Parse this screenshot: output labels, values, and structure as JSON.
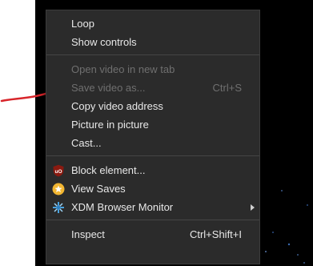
{
  "menu": {
    "items": [
      {
        "label": "Loop",
        "enabled": true
      },
      {
        "label": "Show controls",
        "enabled": true
      },
      {
        "label": "Open video in new tab",
        "enabled": false
      },
      {
        "label": "Save video as...",
        "shortcut": "Ctrl+S",
        "enabled": false
      },
      {
        "label": "Copy video address",
        "enabled": true
      },
      {
        "label": "Picture in picture",
        "enabled": true
      },
      {
        "label": "Cast...",
        "enabled": true
      },
      {
        "label": "Block element...",
        "icon": "ublock-origin-icon",
        "enabled": true
      },
      {
        "label": "View Saves",
        "icon": "view-saves-icon",
        "enabled": true
      },
      {
        "label": "XDM Browser Monitor",
        "icon": "xdm-icon",
        "has_submenu": true,
        "enabled": true
      },
      {
        "label": "Inspect",
        "shortcut": "Ctrl+Shift+I",
        "enabled": true
      }
    ]
  },
  "colors": {
    "menu_bg": "#2b2b2b",
    "text": "#e8e8e8",
    "disabled_text": "#6f6f6f",
    "annotation": "#d8262b"
  }
}
